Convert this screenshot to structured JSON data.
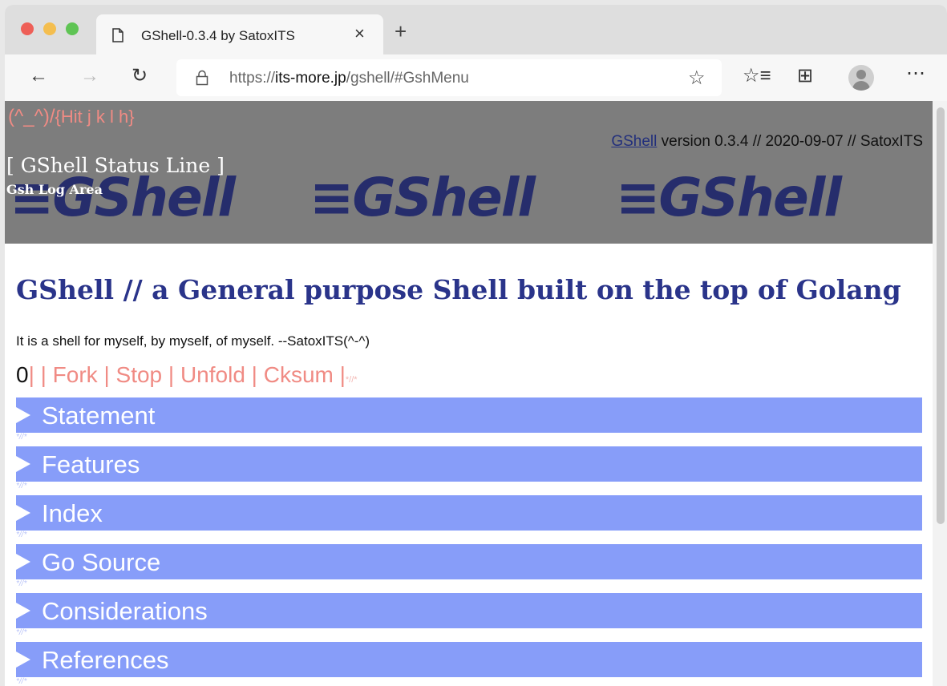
{
  "browser": {
    "tab_title": "GShell-0.3.4 by SatoxITS",
    "tab_close": "×",
    "new_tab": "+",
    "url_prefix": "https://",
    "url_host": "its-more.jp",
    "url_path": "/gshell/#GshMenu",
    "icons": {
      "back": "arrow-left-icon",
      "forward": "arrow-right-icon",
      "reload": "reload-icon",
      "lock": "lock-icon",
      "star": "star-icon",
      "favorites": "favorites-icon",
      "collections": "collections-icon",
      "profile": "profile-icon",
      "more": "more-icon"
    }
  },
  "banner": {
    "smiley": "(^_^)/",
    "hint": "{Hit j k l h}",
    "version_link": "GShell",
    "version_text": " version 0.3.4 // 2020-09-07 // SatoxITS",
    "status_line": "[ GShell Status Line ]",
    "log_area": "Gsh Log Area",
    "logo_text": "GShell",
    "logo_lines": "≡"
  },
  "main": {
    "title": "GShell // a General purpose Shell built on the top of Golang",
    "tagline": "It is a shell for myself, by myself, of myself. --SatoxITS(^-^)",
    "control_number": "0",
    "control_links": "| | Fork | Stop | Unfold | Cksum |",
    "control_mark": "*//*",
    "sections": [
      "Statement",
      "Features",
      "Index",
      "Go Source",
      "Considerations",
      "References"
    ],
    "separator_mark": "*//*"
  },
  "colors": {
    "banner_bg": "#7d7d7d",
    "logo": "#262d6c",
    "accent_pink": "#f08b84",
    "title_blue": "#2a348a",
    "section_bg": "#879df9"
  }
}
